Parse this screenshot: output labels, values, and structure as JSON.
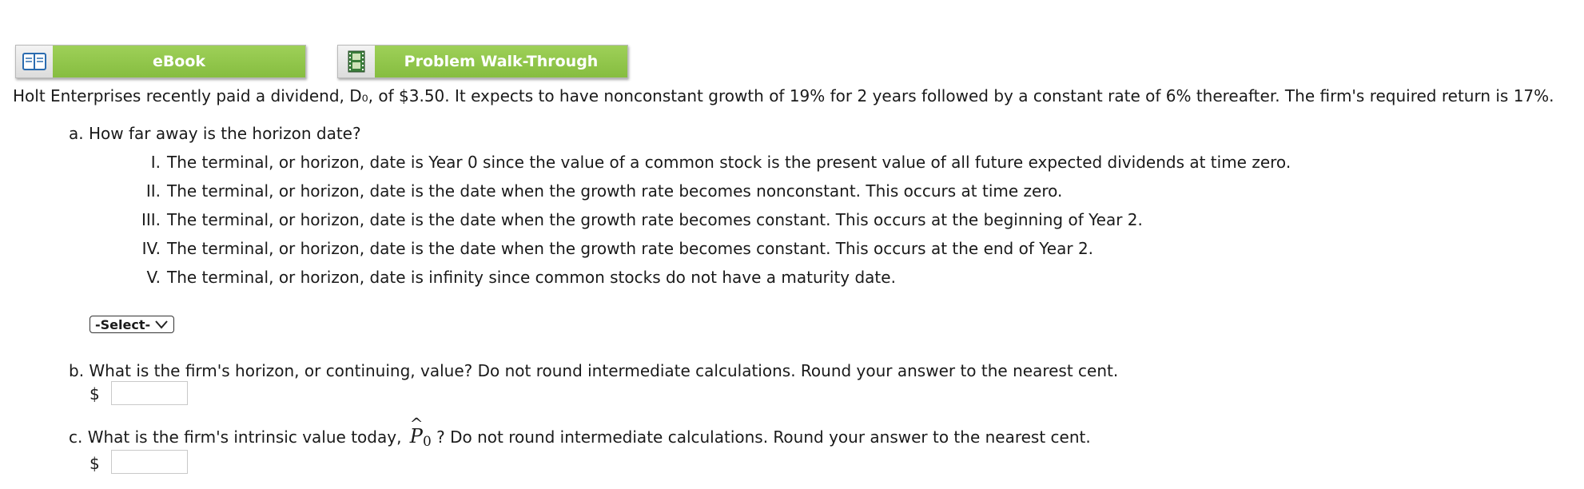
{
  "toolbar": {
    "ebook_label": "eBook",
    "ebook_icon": "book-icon",
    "walkthrough_label": "Problem Walk-Through",
    "walkthrough_icon": "film-icon",
    "label_color": "#8cc44a"
  },
  "intro": "Holt Enterprises recently paid a dividend, D₀, of $3.50. It expects to have nonconstant growth of 19% for 2 years followed by a constant rate of 6% thereafter. The firm's required return is 17%.",
  "question_a": {
    "text": "a. How far away is the horizon date?",
    "options": [
      {
        "num": "I.",
        "text": "The terminal, or horizon, date is Year 0 since the value of a common stock is the present value of all future expected dividends at time zero."
      },
      {
        "num": "II.",
        "text": "The terminal, or horizon, date is the date when the growth rate becomes nonconstant. This occurs at time zero."
      },
      {
        "num": "III.",
        "text": "The terminal, or horizon, date is the date when the growth rate becomes constant. This occurs at the beginning of Year 2."
      },
      {
        "num": "IV.",
        "text": "The terminal, or horizon, date is the date when the growth rate becomes constant. This occurs at the end of Year 2."
      },
      {
        "num": "V.",
        "text": "The terminal, or horizon, date is infinity since common stocks do not have a maturity date."
      }
    ],
    "select_value": "-Select-"
  },
  "question_b": {
    "text": "b. What is the firm's horizon, or continuing, value? Do not round intermediate calculations. Round your answer to the nearest cent.",
    "currency": "$",
    "value": ""
  },
  "question_c": {
    "text_before": "c. What is the firm's intrinsic value today,",
    "symbol": "P",
    "symbol_sub": "0",
    "text_after": "? Do not round intermediate calculations. Round your answer to the nearest cent.",
    "currency": "$",
    "value": ""
  }
}
